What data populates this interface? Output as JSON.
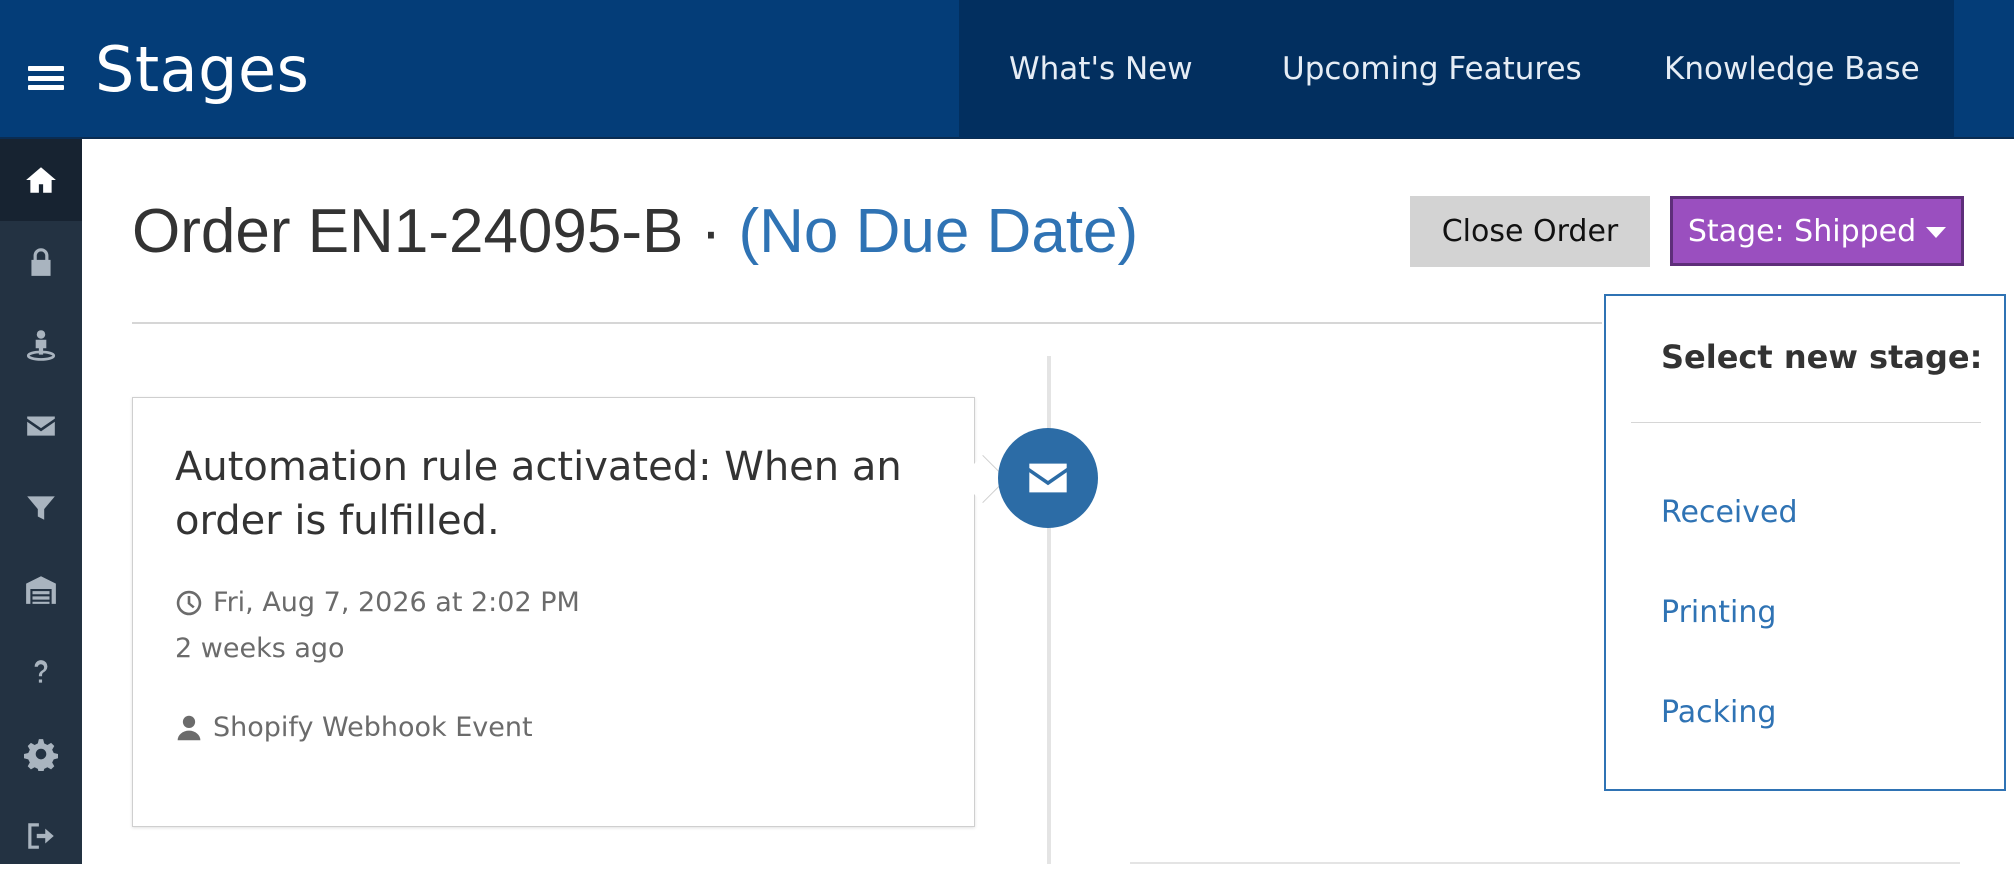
{
  "header": {
    "app_title": "Stages",
    "nav": [
      "What's New",
      "Upcoming Features",
      "Knowledge Base"
    ]
  },
  "sidebar": {
    "items": [
      {
        "icon": "home-icon"
      },
      {
        "icon": "lock-icon"
      },
      {
        "icon": "user-pin-icon"
      },
      {
        "icon": "envelope-icon"
      },
      {
        "icon": "filter-icon"
      },
      {
        "icon": "warehouse-icon"
      },
      {
        "icon": "question-icon"
      },
      {
        "icon": "gear-icon"
      },
      {
        "icon": "sign-out-icon"
      }
    ]
  },
  "order": {
    "title": "Order EN1-24095-B · ",
    "due_date": "(No Due Date)",
    "close_label": "Close Order",
    "stage_label": "Stage: Shipped"
  },
  "timeline": {
    "event_title": "Automation rule activated: When an order is fulfilled.",
    "timestamp": "Fri, Aug 7, 2026 at 2:02 PM",
    "relative_time": "2 weeks ago",
    "actor": "Shopify Webhook Event",
    "badge_icon": "envelope-icon"
  },
  "stage_dropdown": {
    "header": "Select new stage:",
    "options": [
      "Received",
      "Printing",
      "Packing"
    ]
  },
  "colors": {
    "topbar": "#043d78",
    "topnav": "#022f5f",
    "sidebar": "#233242",
    "stage_button": "#9a4fbf",
    "link": "#2f73b4",
    "badge": "#2c6ca6"
  }
}
